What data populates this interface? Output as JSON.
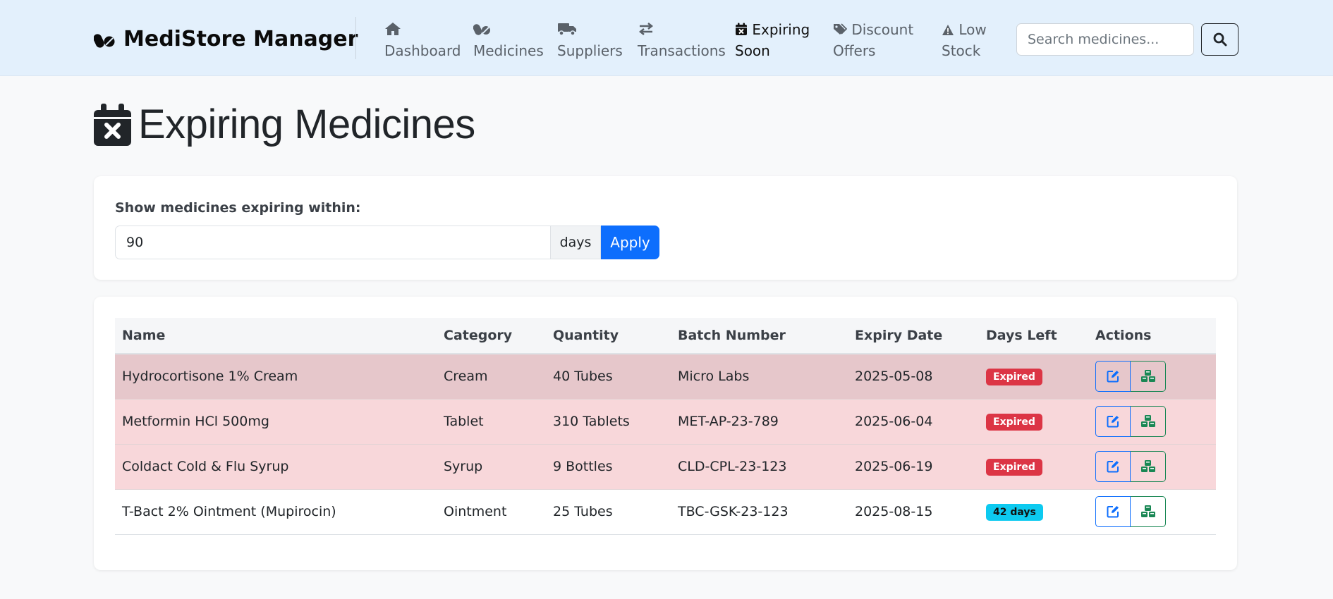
{
  "app": {
    "name": "MediStore Manager"
  },
  "nav": {
    "items": [
      {
        "label": "Dashboard",
        "icon": "home-icon"
      },
      {
        "label": "Medicines",
        "icon": "pills-icon"
      },
      {
        "label": "Suppliers",
        "icon": "truck-icon"
      },
      {
        "label": "Transactions",
        "icon": "exchange-icon"
      },
      {
        "label": "Expiring\nSoon",
        "icon": "calendar-x-icon",
        "active": true
      },
      {
        "label": "Discount\nOffers",
        "icon": "tags-icon"
      },
      {
        "label": "Low\nStock",
        "icon": "warning-icon"
      }
    ],
    "search_placeholder": "Search medicines..."
  },
  "page": {
    "title": "Expiring Medicines"
  },
  "filter": {
    "label": "Show medicines expiring within:",
    "value": "90",
    "unit": "days",
    "apply_label": "Apply"
  },
  "table": {
    "headers": [
      "Name",
      "Category",
      "Quantity",
      "Batch Number",
      "Expiry Date",
      "Days Left",
      "Actions"
    ],
    "rows": [
      {
        "name": "Hydrocortisone 1% Cream",
        "category": "Cream",
        "quantity": "40 Tubes",
        "batch": "Micro Labs",
        "expiry": "2025-05-08",
        "days_left": "Expired",
        "status": "expired"
      },
      {
        "name": "Metformin HCl 500mg",
        "category": "Tablet",
        "quantity": "310 Tablets",
        "batch": "MET-AP-23-789",
        "expiry": "2025-06-04",
        "days_left": "Expired",
        "status": "expired"
      },
      {
        "name": "Coldact Cold & Flu Syrup",
        "category": "Syrup",
        "quantity": "9 Bottles",
        "batch": "CLD-CPL-23-123",
        "expiry": "2025-06-19",
        "days_left": "Expired",
        "status": "expired"
      },
      {
        "name": "T-Bact 2% Ointment (Mupirocin)",
        "category": "Ointment",
        "quantity": "25 Tubes",
        "batch": "TBC-GSK-23-123",
        "expiry": "2025-08-15",
        "days_left": "42 days",
        "status": "ok"
      }
    ]
  },
  "colors": {
    "primary": "#0d6efd",
    "danger": "#dc3545",
    "info": "#0dcaf0",
    "success": "#198754",
    "navbar_bg": "#e3f0fc"
  }
}
